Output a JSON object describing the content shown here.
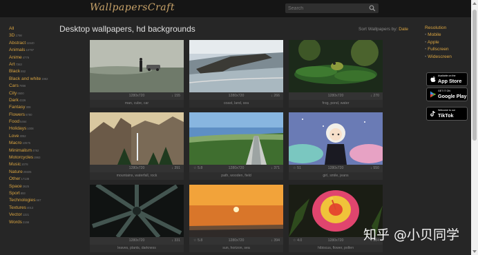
{
  "header": {
    "logo": "WallpapersCraft",
    "search_placeholder": "Search"
  },
  "sidebar": {
    "items": [
      {
        "label": "All",
        "count": ""
      },
      {
        "label": "3D",
        "count": "1798"
      },
      {
        "label": "Abstract",
        "count": "11540"
      },
      {
        "label": "Animals",
        "count": "10797"
      },
      {
        "label": "Anime",
        "count": "4776"
      },
      {
        "label": "Art",
        "count": "7363"
      },
      {
        "label": "Black",
        "count": "652"
      },
      {
        "label": "Black and white",
        "count": "1962"
      },
      {
        "label": "Cars",
        "count": "7856"
      },
      {
        "label": "City",
        "count": "6500"
      },
      {
        "label": "Dark",
        "count": "4326"
      },
      {
        "label": "Fantasy",
        "count": "308"
      },
      {
        "label": "Flowers",
        "count": "5780"
      },
      {
        "label": "Food",
        "count": "5464"
      },
      {
        "label": "Holidays",
        "count": "1008"
      },
      {
        "label": "Love",
        "count": "3052"
      },
      {
        "label": "Macro",
        "count": "10575"
      },
      {
        "label": "Minimalism",
        "count": "4792"
      },
      {
        "label": "Motorcycles",
        "count": "2863"
      },
      {
        "label": "Music",
        "count": "2078"
      },
      {
        "label": "Nature",
        "count": "25505"
      },
      {
        "label": "Other",
        "count": "17138"
      },
      {
        "label": "Space",
        "count": "2625"
      },
      {
        "label": "Sport",
        "count": "893"
      },
      {
        "label": "Technologies",
        "count": "967"
      },
      {
        "label": "Textures",
        "count": "4013"
      },
      {
        "label": "Vector",
        "count": "1321"
      },
      {
        "label": "Words",
        "count": "2156"
      }
    ]
  },
  "main": {
    "title": "Desktop wallpapers, hd backgrounds",
    "sort_label": "Sort Wallpapers by:",
    "sort_value": "Date",
    "cards": [
      {
        "res": "1280x720",
        "rate": "",
        "dl": "↓ 155",
        "tags": "man, cube, car",
        "image": "foggy-field"
      },
      {
        "res": "1280x720",
        "rate": "",
        "dl": "↓ 266",
        "tags": "coast, land, sea",
        "image": "coast"
      },
      {
        "res": "1280x720",
        "rate": "",
        "dl": "↓ 270",
        "tags": "frog, pond, water",
        "image": "frog"
      },
      {
        "res": "1280x720",
        "rate": "",
        "dl": "↓ 391",
        "tags": "mountains, waterfall, rock",
        "image": "mountains"
      },
      {
        "res": "1280x720",
        "rate": "☆ 5.8",
        "dl": "↓ 371",
        "tags": "path, wooden, field",
        "image": "path"
      },
      {
        "res": "1280x720",
        "rate": "☆ 51",
        "dl": "↓ 550",
        "tags": "girl, smile, jeans",
        "image": "anime-girl"
      },
      {
        "res": "1280x720",
        "rate": "",
        "dl": "↓ 331",
        "tags": "leaves, plants, darkness",
        "image": "dark-leaves"
      },
      {
        "res": "1280x720",
        "rate": "☆ 5.8",
        "dl": "↓ 394",
        "tags": "sun, horizon, sea",
        "image": "sunset"
      },
      {
        "res": "1280x720",
        "rate": "☆ 4.0",
        "dl": "↓ 284",
        "tags": "hibiscus, flower, pollen",
        "image": "hibiscus"
      }
    ]
  },
  "right": {
    "heading": "Resolution",
    "items": [
      "Mobile",
      "Apple",
      "Fullscreen",
      "Widescreen"
    ],
    "badges": [
      {
        "small": "Available on the",
        "big": "App Store",
        "icon": "apple-icon"
      },
      {
        "small": "GET IT ON",
        "big": "Google Play",
        "icon": "google-play-icon"
      },
      {
        "small": "Welcome to our",
        "big": "TikTok",
        "icon": "tiktok-icon"
      }
    ]
  },
  "watermark": "知乎 @小贝同学"
}
